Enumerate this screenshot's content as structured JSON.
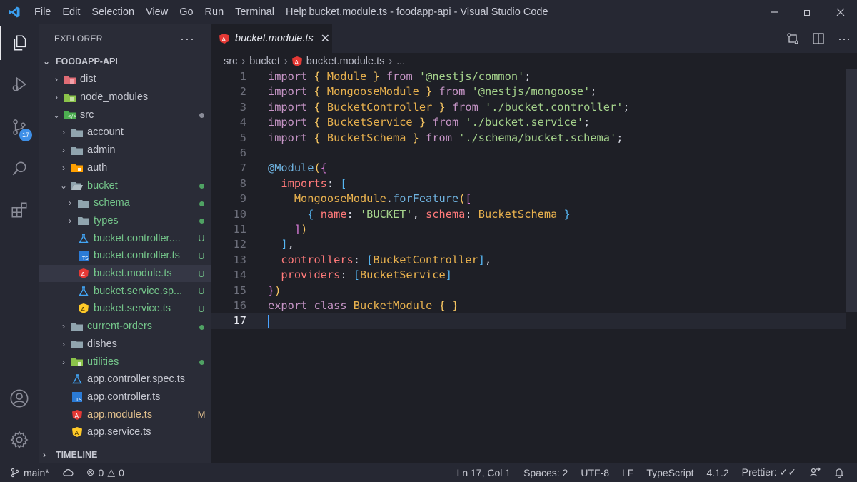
{
  "window": {
    "title": "bucket.module.ts - foodapp-api - Visual Studio Code",
    "menu": [
      "File",
      "Edit",
      "Selection",
      "View",
      "Go",
      "Run",
      "Terminal",
      "Help"
    ]
  },
  "activity": {
    "scm_badge": "17"
  },
  "explorer": {
    "header": "EXPLORER",
    "more": "···",
    "project": "FOODAPP-API",
    "timeline": "TIMELINE",
    "items": [
      {
        "label": "dist",
        "status": ""
      },
      {
        "label": "node_modules",
        "status": ""
      },
      {
        "label": "src",
        "status": "dot-grey"
      },
      {
        "label": "account",
        "status": ""
      },
      {
        "label": "admin",
        "status": ""
      },
      {
        "label": "auth",
        "status": ""
      },
      {
        "label": "bucket",
        "status": "dot"
      },
      {
        "label": "schema",
        "status": "dot"
      },
      {
        "label": "types",
        "status": "dot"
      },
      {
        "label": "bucket.controller....",
        "status": "U"
      },
      {
        "label": "bucket.controller.ts",
        "status": "U"
      },
      {
        "label": "bucket.module.ts",
        "status": "U"
      },
      {
        "label": "bucket.service.sp...",
        "status": "U"
      },
      {
        "label": "bucket.service.ts",
        "status": "U"
      },
      {
        "label": "current-orders",
        "status": "dot"
      },
      {
        "label": "dishes",
        "status": ""
      },
      {
        "label": "utilities",
        "status": "dot"
      },
      {
        "label": "app.controller.spec.ts",
        "status": ""
      },
      {
        "label": "app.controller.ts",
        "status": ""
      },
      {
        "label": "app.module.ts",
        "status": "M"
      },
      {
        "label": "app.service.ts",
        "status": ""
      }
    ]
  },
  "editor": {
    "tab_label": "bucket.module.ts",
    "breadcrumbs": [
      "src",
      "bucket",
      "bucket.module.ts",
      "..."
    ],
    "line_numbers": [
      "1",
      "2",
      "3",
      "4",
      "5",
      "6",
      "7",
      "8",
      "9",
      "10",
      "11",
      "12",
      "13",
      "14",
      "15",
      "16",
      "17"
    ],
    "code": [
      "import { Module } from '@nestjs/common';",
      "import { MongooseModule } from '@nestjs/mongoose';",
      "import { BucketController } from './bucket.controller';",
      "import { BucketService } from './bucket.service';",
      "import { BucketSchema } from './schema/bucket.schema';",
      "",
      "@Module({",
      "  imports: [",
      "    MongooseModule.forFeature([",
      "      { name: 'BUCKET', schema: BucketSchema }",
      "    ])",
      "  ],",
      "  controllers: [BucketController],",
      "  providers: [BucketService]",
      "})",
      "export class BucketModule { }",
      ""
    ]
  },
  "statusbar": {
    "branch": "main*",
    "errors": "0",
    "warnings": "0",
    "position": "Ln 17, Col 1",
    "spaces": "Spaces: 2",
    "encoding": "UTF-8",
    "eol": "LF",
    "language": "TypeScript",
    "ts_version": "4.1.2",
    "prettier": "Prettier: ✓✓"
  }
}
